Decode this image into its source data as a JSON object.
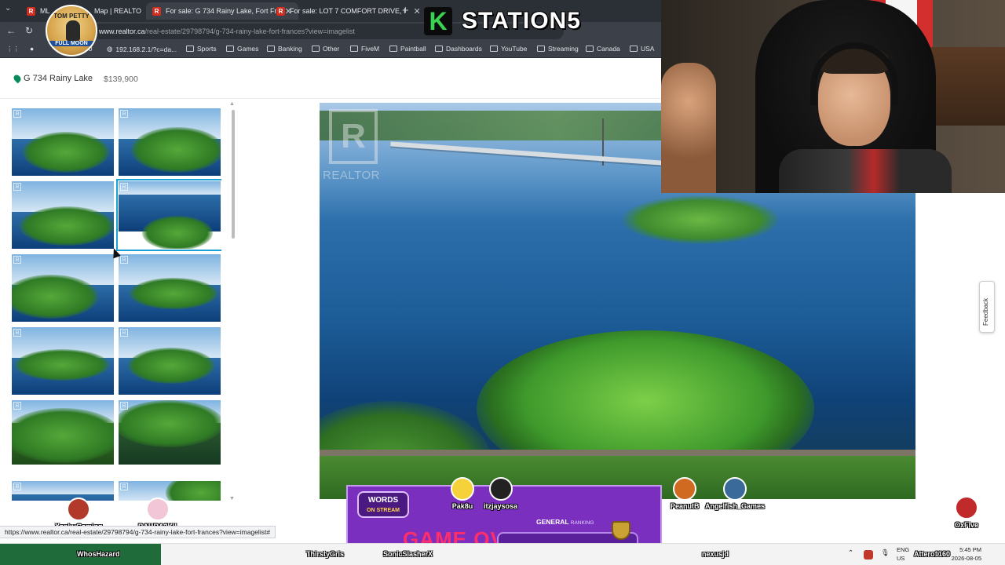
{
  "browser": {
    "tabs": [
      {
        "label": "ML"
      },
      {
        "label": "Map | REALTO"
      },
      {
        "label": "For sale: G 734 Rainy Lake, Fort Fr"
      },
      {
        "label": "For sale: LOT 7 COMFORT DRIVE, I"
      }
    ],
    "new_tab_symbol": "+",
    "url_domain": "www.realtor.ca",
    "url_path": "/real-estate/29798794/g-734-rainy-lake-fort-frances?view=imagelist",
    "bookmarks": [
      {
        "label": "192.168.2.1/?c=da..."
      },
      {
        "label": "Sports"
      },
      {
        "label": "Games"
      },
      {
        "label": "Banking"
      },
      {
        "label": "Other"
      },
      {
        "label": "FiveM"
      },
      {
        "label": "Paintball"
      },
      {
        "label": "Dashboards"
      },
      {
        "label": "YouTube"
      },
      {
        "label": "Streaming"
      },
      {
        "label": "Canada"
      },
      {
        "label": "USA"
      }
    ],
    "bookmark_partial": "00"
  },
  "listing": {
    "title": "G 734 Rainy Lake",
    "price": "$139,900",
    "selected_thumbnail_index": 3,
    "thumbnail_count": 12
  },
  "photo": {
    "watermark_letter": "R",
    "watermark_label": "REALTOR"
  },
  "feedback_label": "Feedback",
  "status_bar_url": "https://www.realtor.ca/real-estate/29798794/g-734-rainy-lake-fort-frances?view=imagelist#",
  "stream": {
    "channel_name": "STATION5",
    "k_logo": "K",
    "badge_top": "TOM PETTY",
    "badge_bottom": "FULL MOON",
    "widget": {
      "logo_line1": "WORDS",
      "logo_line2": "ON STREAM",
      "ranking_title": "GENERAL",
      "ranking_sub": "RANKING",
      "game_over": "GAME OVER"
    },
    "viewers": [
      {
        "name": "XankuGaming"
      },
      {
        "name": "BAURA2KII"
      },
      {
        "name": "Pak8u"
      },
      {
        "name": "itzjaysosa"
      },
      {
        "name": "PeanutB"
      },
      {
        "name": "Angelfish_Games"
      },
      {
        "name": "OxFive"
      },
      {
        "name": "WhosHazard"
      },
      {
        "name": "ThirstyGris"
      },
      {
        "name": "SonicSlasherX"
      },
      {
        "name": "nexusjd"
      },
      {
        "name": "Attero1160"
      }
    ]
  },
  "taskbar": {
    "lang_line1": "ENG",
    "lang_line2": "US",
    "time": "5:45 PM",
    "date": "2026-08-05"
  }
}
